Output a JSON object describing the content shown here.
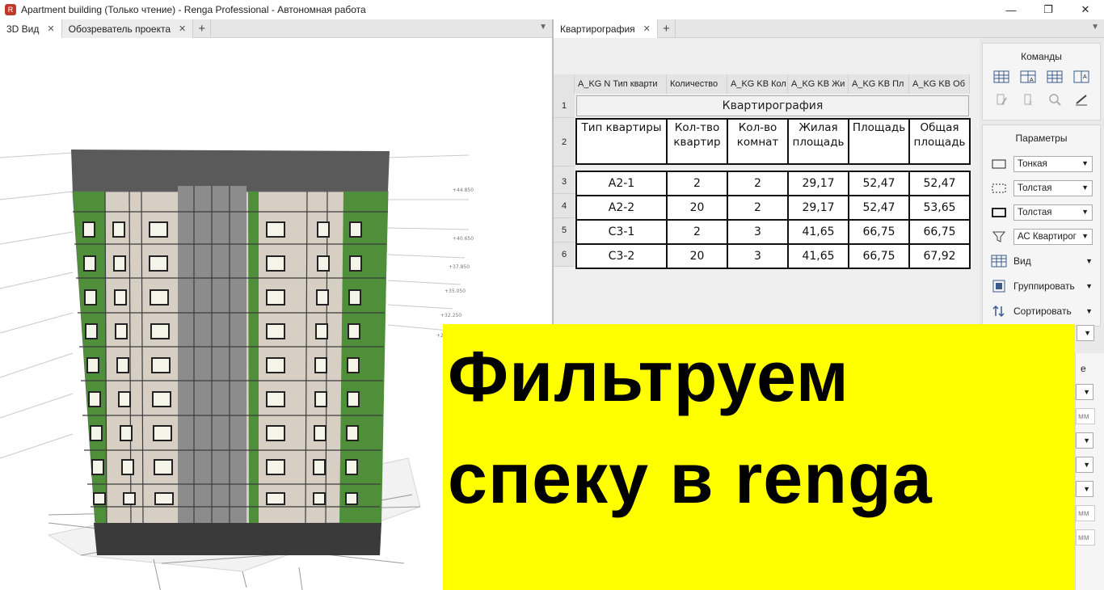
{
  "window": {
    "title": "Apartment building (Только чтение) - Renga Professional - Автономная работа",
    "icon": "renga-logo-icon",
    "controls": [
      "—",
      "❐",
      "✕"
    ]
  },
  "left_tabs": [
    {
      "label": "3D Вид",
      "close": "✕"
    },
    {
      "label": "Обозреватель проекта",
      "close": "✕"
    }
  ],
  "right_tabs": [
    {
      "label": "Квартирография",
      "close": "✕"
    }
  ],
  "tab_add": "+",
  "tab_menu": "▼",
  "sheet": {
    "columns": [
      "A_KG N Тип кварти",
      "Количество",
      "A_KG KB Кол",
      "A_KG KB Жи",
      "A_KG KB Пл",
      "A_KG KB Об"
    ],
    "row_numbers": [
      "1",
      "2",
      "3",
      "4",
      "5",
      "6"
    ],
    "title": "Квартирография",
    "headers": [
      "Тип квартиры",
      "Кол-тво квартир",
      "Кол-во комнат",
      "Жилая площадь",
      "Площадь",
      "Общая площадь"
    ],
    "rows": [
      [
        "А2-1",
        "2",
        "2",
        "29,17",
        "52,47",
        "52,47"
      ],
      [
        "А2-2",
        "20",
        "2",
        "29,17",
        "52,47",
        "53,65"
      ],
      [
        "С3-1",
        "2",
        "3",
        "41,65",
        "66,75",
        "66,75"
      ],
      [
        "С3-2",
        "20",
        "3",
        "41,65",
        "66,75",
        "67,92"
      ]
    ]
  },
  "side": {
    "commands_title": "Команды",
    "params_title": "Параметры",
    "line_thin": "Тонкая",
    "line_thick_1": "Толстая",
    "line_thick_2": "Толстая",
    "filter": "АС Квартирог",
    "view": "Вид",
    "group": "Группировать",
    "sort": "Сортировать",
    "arrow": "▼",
    "strip_letter": "е",
    "mm": "мм"
  },
  "banner": {
    "line1": "Фильтруем",
    "line2": "спеку в renga",
    "color": "#ffff00"
  },
  "building_colors": {
    "green": "#4f8f3a",
    "beige": "#d8cfc4",
    "roof": "#5a5a5a",
    "grey": "#8a8a8a"
  }
}
